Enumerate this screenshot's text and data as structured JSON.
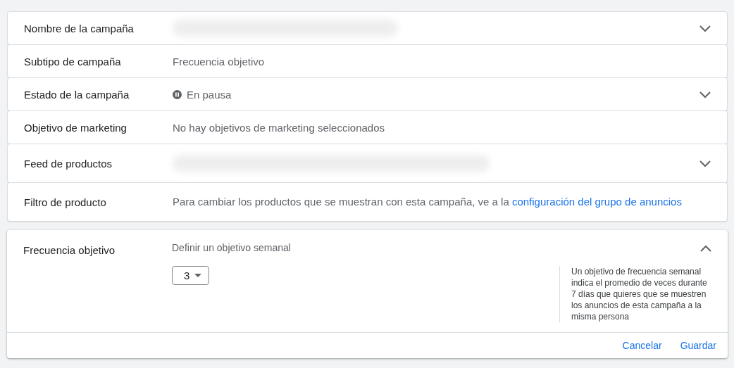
{
  "rows": [
    {
      "label": "Nombre de la campaña",
      "kind": "redacted",
      "expandable": true
    },
    {
      "label": "Subtipo de campaña",
      "kind": "text",
      "value": "Frecuencia objetivo",
      "expandable": false
    },
    {
      "label": "Estado de la campaña",
      "kind": "status",
      "value": "En pausa",
      "expandable": true
    },
    {
      "label": "Objetivo de marketing",
      "kind": "text",
      "value": "No hay objetivos de marketing seleccionados",
      "expandable": false
    },
    {
      "label": "Feed de productos",
      "kind": "redacted",
      "expandable": true
    },
    {
      "label": "Filtro de producto",
      "kind": "link_text",
      "value": "Para cambiar los productos que se muestran con esta campaña, ve a la",
      "link": "configuración del grupo de anuncios",
      "expandable": false
    }
  ],
  "editor": {
    "label": "Frecuencia objetivo",
    "expanded": true,
    "prompt": "Definir un objetivo semanal",
    "select": {
      "value": "3"
    },
    "help": "Un objetivo de frecuencia semanal indica el promedio de veces durante 7 días que quieres que se muestren los anuncios de esta campaña a la misma persona",
    "buttons": [
      "Cancelar",
      "Guardar"
    ]
  }
}
